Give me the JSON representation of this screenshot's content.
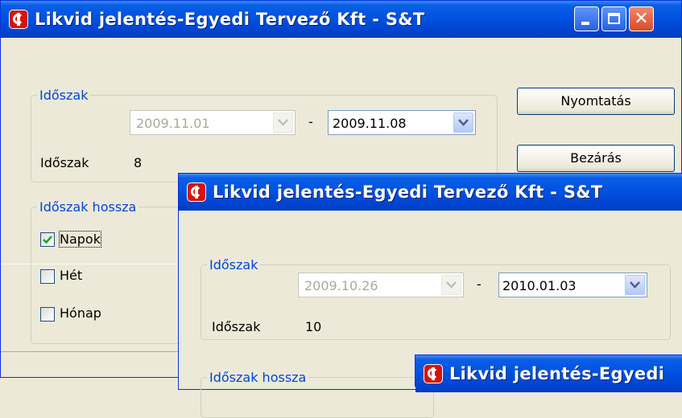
{
  "window1": {
    "title": "Likvid jelentés-Egyedi Tervező  Kft - S&T",
    "period_group": "Időszak",
    "date_from": "2009.11.01",
    "dash": "-",
    "date_to": "2009.11.08",
    "period_label": "Időszak",
    "period_value": "8",
    "length_group": "Időszak hossza",
    "checkboxes": [
      {
        "label": "Napok",
        "checked": true
      },
      {
        "label": "Hét",
        "checked": false
      },
      {
        "label": "Hónap",
        "checked": false
      }
    ],
    "print_button": "Nyomtatás",
    "close_button": "Bezárás"
  },
  "window2": {
    "title": "Likvid jelentés-Egyedi Tervező  Kft - S&T",
    "period_group": "Időszak",
    "date_from": "2009.10.26",
    "dash": "-",
    "date_to": "2010.01.03",
    "period_label": "Időszak",
    "period_value": "10",
    "length_group": "Időszak hossza"
  },
  "window3": {
    "title_partial": "Likvid jelentés-Egyedi"
  },
  "colors": {
    "title_bar": "#0052e0",
    "group_label": "#0046d5",
    "face": "#ece9d8"
  }
}
